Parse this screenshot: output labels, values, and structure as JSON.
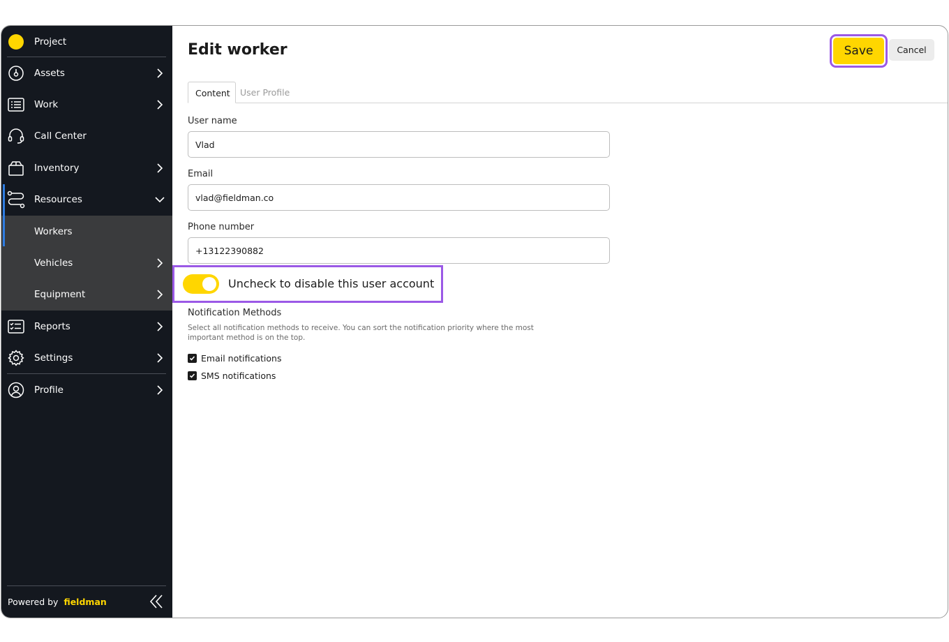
{
  "sidebar": {
    "items": [
      {
        "label": "Project",
        "icon": "project-dot-icon"
      },
      {
        "label": "Assets",
        "icon": "gauge-icon"
      },
      {
        "label": "Work",
        "icon": "list-icon"
      },
      {
        "label": "Call Center",
        "icon": "headset-icon"
      },
      {
        "label": "Inventory",
        "icon": "box-icon"
      },
      {
        "label": "Resources",
        "icon": "route-icon"
      },
      {
        "label": "Workers"
      },
      {
        "label": "Vehicles"
      },
      {
        "label": "Equipment"
      },
      {
        "label": "Reports",
        "icon": "checklist-icon"
      },
      {
        "label": "Settings",
        "icon": "gear-icon"
      },
      {
        "label": "Profile",
        "icon": "user-circle-icon"
      }
    ],
    "footer": {
      "powered_by": "Powered by",
      "brand": "fieldman"
    }
  },
  "colors": {
    "accent": "#ffd600",
    "highlight": "#9b59e6",
    "sidebar_bg": "#14181f",
    "active_marker": "#2f7de1"
  },
  "header": {
    "title": "Edit worker",
    "save_label": "Save",
    "cancel_label": "Cancel"
  },
  "tabs": [
    {
      "label": "Content"
    },
    {
      "label": "User Profile"
    }
  ],
  "form": {
    "username": {
      "label": "User name",
      "value": "Vlad"
    },
    "email": {
      "label": "Email",
      "value": "vlad@fieldman.co"
    },
    "phone": {
      "label": "Phone number",
      "value": "+13122390882"
    },
    "account_toggle": {
      "label": "Uncheck to disable this user account",
      "checked": true
    },
    "notifications": {
      "title": "Notification Methods",
      "description": "Select all notification methods to receive. You can sort the notification priority where the most important method is on the top.",
      "options": [
        {
          "label": "Email notifications",
          "checked": true
        },
        {
          "label": "SMS notifications",
          "checked": true
        }
      ]
    }
  }
}
